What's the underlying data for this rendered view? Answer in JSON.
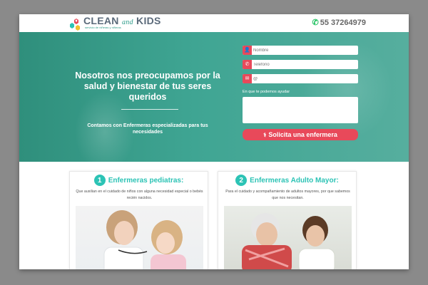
{
  "brand": {
    "name_part1": "CLEAN",
    "name_and": "and",
    "name_part2": "KIDS",
    "tagline": "servicio de niñeras y niñeras"
  },
  "header": {
    "phone_icon": "whatsapp-icon",
    "phone": "55 37264979"
  },
  "hero": {
    "title": "Nosotros nos preocupamos por la salud y bienestar de tus seres queridos",
    "subtitle": "Contamos con Enfermeras especializadas para tus necesidades"
  },
  "form": {
    "name_placeholder": "Nombre",
    "phone_placeholder": "Telefono",
    "email_placeholder": "@",
    "help_label": "En que te podemos ayudar",
    "submit_label": "Solicita una enfermera",
    "icons": [
      "user-icon",
      "phone-icon",
      "email-icon"
    ]
  },
  "services": [
    {
      "number": "1",
      "title": "Enfermeras pediatras:",
      "description": "Que auxilian en el cuidado de niños con alguna necesidad especial o bebés recién nacidos."
    },
    {
      "number": "2",
      "title": "Enfermeras Adulto Mayor:",
      "description": "Para el cuidado y acompañamiento de adultos mayores, por que sabemos que nos necesitan."
    }
  ],
  "colors": {
    "teal": "#3a9c8a",
    "accent": "#e8495a",
    "badge": "#2cc3b5",
    "whatsapp": "#27c365"
  }
}
